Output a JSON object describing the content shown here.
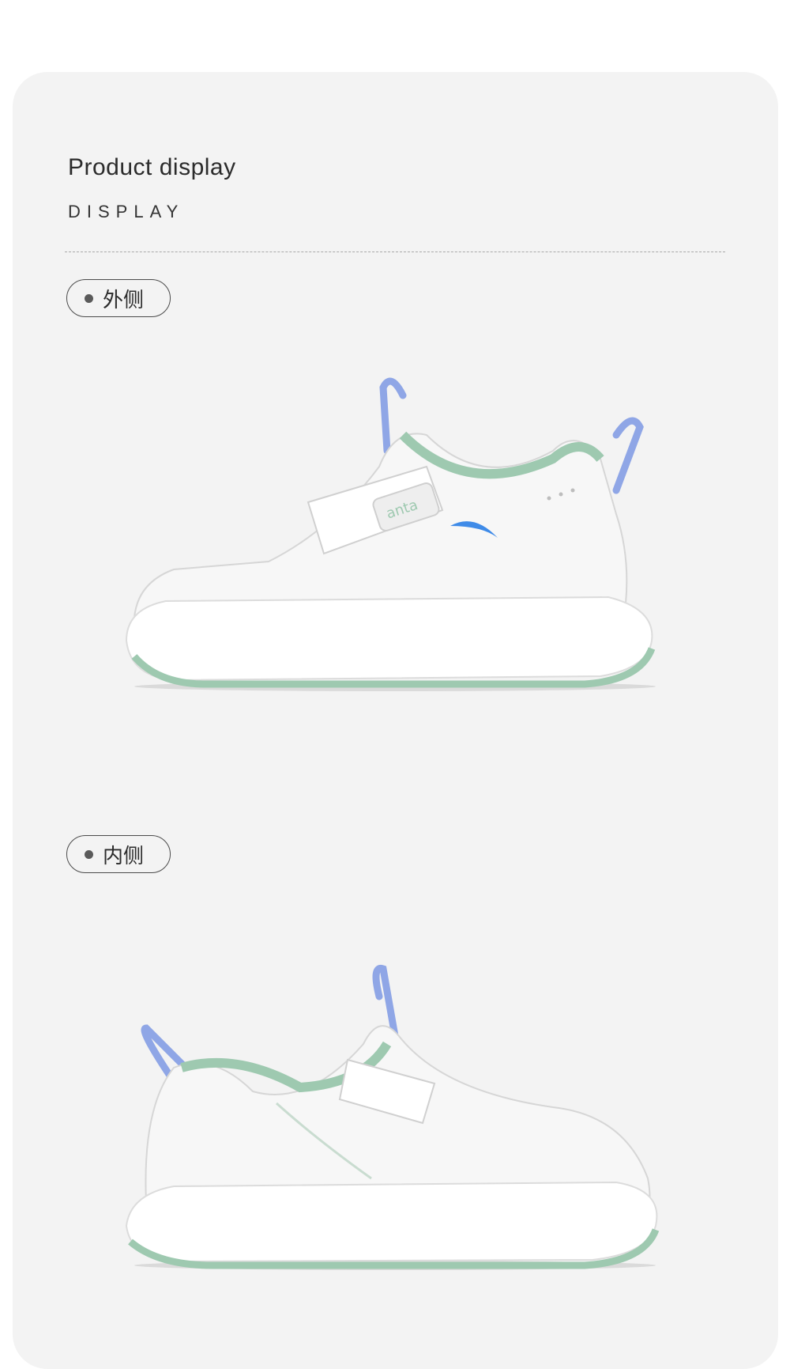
{
  "section": {
    "title": "Product display",
    "subtitle": "DISPLAY"
  },
  "views": [
    {
      "label": "外侧",
      "logo_text": "anta"
    },
    {
      "label": "内侧"
    }
  ],
  "colors": {
    "panel": "#f3f3f3",
    "accent_green": "#9ec9b0",
    "accent_blue": "#8fa6e6",
    "logo_blue": "#3f8be8",
    "shoe_white": "#f7f7f7"
  }
}
